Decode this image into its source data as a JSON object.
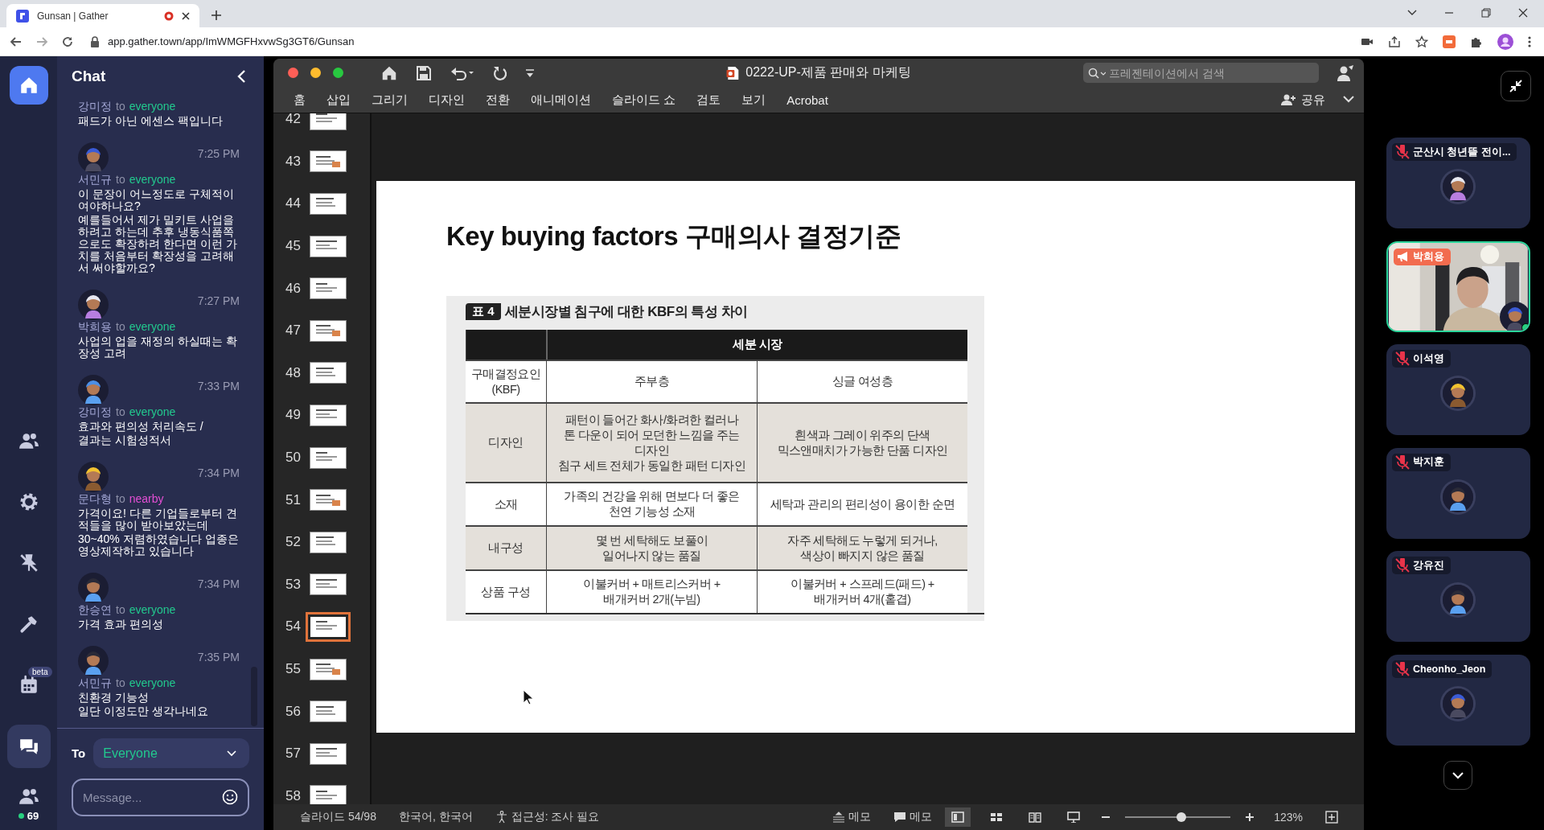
{
  "browser": {
    "tabs": [
      {
        "title": "Gunsan | Gather",
        "selected": true,
        "recording": true
      }
    ],
    "url": "app.gather.town/app/ImWMGFHxvwSg3GT6/Gunsan"
  },
  "rail": {
    "items": [
      {
        "kind": "people",
        "selected": false
      },
      {
        "kind": "settings",
        "selected": false
      },
      {
        "kind": "pin",
        "selected": false
      },
      {
        "kind": "build",
        "selected": false
      },
      {
        "kind": "calendar",
        "selected": false,
        "badge": "beta"
      },
      {
        "kind": "chat",
        "selected": true
      }
    ],
    "participants": {
      "count": "69"
    }
  },
  "chat": {
    "title": "Chat",
    "messages": [
      {
        "partial": true,
        "sender": "강미정",
        "to_label": "to",
        "recipient": "everyone",
        "color": "#22c98e",
        "paragraphs": [
          "패드가 아닌 에센스 팩입니다"
        ]
      },
      {
        "partial": false,
        "time": "7:25 PM",
        "sender": "서민규",
        "to_label": "to",
        "recipient": "everyone",
        "color": "#22c98e",
        "paragraphs": [
          "이 문장이 어느정도로 구체적이여야하나요?",
          "예를들어서 제가 밀키트 사업을 하려고 하는데 추후 냉동식품쪽으로도 확장하려 한다면 이런 가치를 처음부터 확장성을 고려해서 써야할까요?"
        ]
      },
      {
        "partial": false,
        "time": "7:27 PM",
        "sender": "박희용",
        "to_label": "to",
        "recipient": "everyone",
        "color": "#22c98e",
        "paragraphs": [
          "사업의 업을 재정의 하실때는 확장성 고려"
        ]
      },
      {
        "partial": false,
        "time": "7:33 PM",
        "sender": "강미정",
        "to_label": "to",
        "recipient": "everyone",
        "color": "#22c98e",
        "paragraphs": [
          "효과와 편의성 처리속도 /",
          "결과는 시험성적서"
        ]
      },
      {
        "partial": false,
        "time": "7:34 PM",
        "sender": "문다형",
        "to_label": "to",
        "recipient": "nearby",
        "color": "#e34fd4",
        "paragraphs": [
          "가격이요! 다른 기업들로부터 견적들을 많이 받아보았는데",
          "30~40% 저렴하였습니다 업종은 영상제작하고 있습니다"
        ]
      },
      {
        "partial": false,
        "time": "7:34 PM",
        "sender": "한승연",
        "to_label": "to",
        "recipient": "everyone",
        "color": "#22c98e",
        "paragraphs": [
          "가격 효과 편의성"
        ]
      },
      {
        "partial": false,
        "time": "7:35 PM",
        "sender": "서민규",
        "to_label": "to",
        "recipient": "everyone",
        "color": "#22c98e",
        "paragraphs": [
          "친환경 기능성",
          "일단 이정도만 생각나네요"
        ]
      }
    ],
    "to": {
      "label": "To",
      "value": "Everyone"
    },
    "message_field": {
      "placeholder": "Message..."
    }
  },
  "presentation": {
    "title": "0222-UP-제품 판매와 마케팅",
    "search": {
      "placeholder": "프레젠테이션에서 검색"
    },
    "ribbon_tabs": [
      "홈",
      "삽입",
      "그리기",
      "디자인",
      "전환",
      "애니메이션",
      "슬라이드 쇼",
      "검토",
      "보기",
      "Acrobat"
    ],
    "share": "공유",
    "thumbnails": [
      {
        "number": "42",
        "selected": false
      },
      {
        "number": "43",
        "selected": false
      },
      {
        "number": "44",
        "selected": false
      },
      {
        "number": "45",
        "selected": false
      },
      {
        "number": "46",
        "selected": false
      },
      {
        "number": "47",
        "selected": false
      },
      {
        "number": "48",
        "selected": false
      },
      {
        "number": "49",
        "selected": false
      },
      {
        "number": "50",
        "selected": false
      },
      {
        "number": "51",
        "selected": false
      },
      {
        "number": "52",
        "selected": false
      },
      {
        "number": "53",
        "selected": false
      },
      {
        "number": "54",
        "selected": true
      },
      {
        "number": "55",
        "selected": false
      },
      {
        "number": "56",
        "selected": false
      },
      {
        "number": "57",
        "selected": false
      },
      {
        "number": "58",
        "selected": false
      }
    ],
    "slide": {
      "title": "Key buying factors 구매의사 결정기준",
      "figure": {
        "badge": "표 4",
        "caption": "세분시장별 침구에 대한 KBF의 특성 차이",
        "group_header": "세분 시장",
        "header": [
          "구매결정요인\n(KBF)",
          "주부층",
          "싱글 여성층"
        ],
        "rows": [
          {
            "shaded": true,
            "cells": [
              "디자인",
              "패턴이 들어간 화사/화려한 컬러나\n톤 다운이 되어 모던한 느낌을 주는\n디자인\n침구 세트 전체가 동일한 패턴 디자인",
              "흰색과 그레이 위주의 단색\n믹스앤매치가 가능한 단품 디자인"
            ]
          },
          {
            "shaded": false,
            "cells": [
              "소재",
              "가족의 건강을 위해 면보다 더 좋은\n천연 기능성 소재",
              "세탁과 관리의 편리성이 용이한 순면"
            ]
          },
          {
            "shaded": true,
            "cells": [
              "내구성",
              "몇 번 세탁해도 보풀이\n일어나지 않는 품질",
              "자주 세탁해도 누렇게 되거나,\n색상이 빠지지 않은 품질"
            ]
          },
          {
            "shaded": false,
            "cells": [
              "상품 구성",
              "이불커버 + 매트리스커버 +\n배개커버 2개(누빔)",
              "이불커버 + 스프레드(패드) +\n배개커버 4개(홑겹)"
            ]
          }
        ]
      }
    },
    "status": {
      "slide_counter": "슬라이드 54/98",
      "language": "한국어, 한국어",
      "accessibility": "접근성: 조사 필요",
      "notes": "메모",
      "comments": "메모",
      "views": [
        {
          "kind": "normal",
          "selected": true
        },
        {
          "kind": "sorter",
          "selected": false
        },
        {
          "kind": "reading",
          "selected": false
        },
        {
          "kind": "slideshow",
          "selected": false
        }
      ],
      "zoom": {
        "level": 0.53,
        "value": "123%"
      }
    }
  },
  "participants": [
    {
      "name": "군산시 청년뜰 전이...",
      "kind": "avatar",
      "muted": true,
      "speaking": false
    },
    {
      "name": "박희용",
      "kind": "video",
      "muted": false,
      "speaking": true
    },
    {
      "name": "이석영",
      "kind": "avatar",
      "muted": true,
      "speaking": false
    },
    {
      "name": "박지훈",
      "kind": "avatar",
      "muted": true,
      "speaking": false
    },
    {
      "name": "강유진",
      "kind": "avatar",
      "muted": true,
      "speaking": false
    },
    {
      "name": "Cheonho_Jeon",
      "kind": "avatar",
      "muted": true,
      "speaking": false
    }
  ]
}
